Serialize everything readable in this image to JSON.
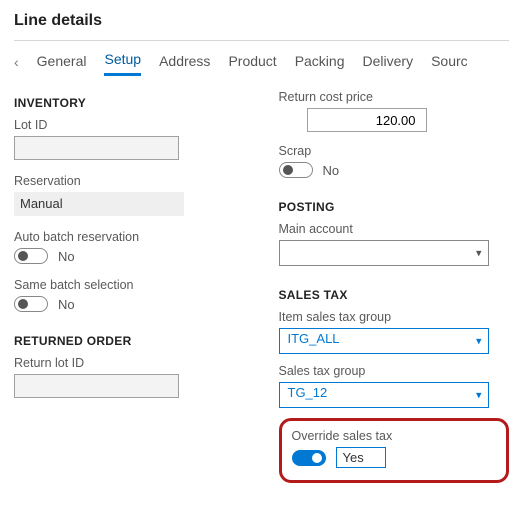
{
  "title": "Line details",
  "tabs": {
    "items": [
      "General",
      "Setup",
      "Address",
      "Product",
      "Packing",
      "Delivery",
      "Sourc"
    ],
    "active_index": 1
  },
  "left": {
    "inventory": {
      "heading": "INVENTORY",
      "lot_id_label": "Lot ID",
      "lot_id_value": "",
      "reservation_label": "Reservation",
      "reservation_value": "Manual",
      "auto_batch_label": "Auto batch reservation",
      "auto_batch_value": "No",
      "same_batch_label": "Same batch selection",
      "same_batch_value": "No"
    },
    "returned": {
      "heading": "RETURNED ORDER",
      "return_lot_label": "Return lot ID",
      "return_lot_value": ""
    }
  },
  "right": {
    "cost": {
      "return_cost_label": "Return cost price",
      "return_cost_value": "120.00",
      "scrap_label": "Scrap",
      "scrap_value": "No"
    },
    "posting": {
      "heading": "POSTING",
      "main_account_label": "Main account",
      "main_account_value": ""
    },
    "salestax": {
      "heading": "SALES TAX",
      "item_group_label": "Item sales tax group",
      "item_group_value": "ITG_ALL",
      "group_label": "Sales tax group",
      "group_value": "TG_12",
      "override_label": "Override sales tax",
      "override_value": "Yes"
    }
  }
}
